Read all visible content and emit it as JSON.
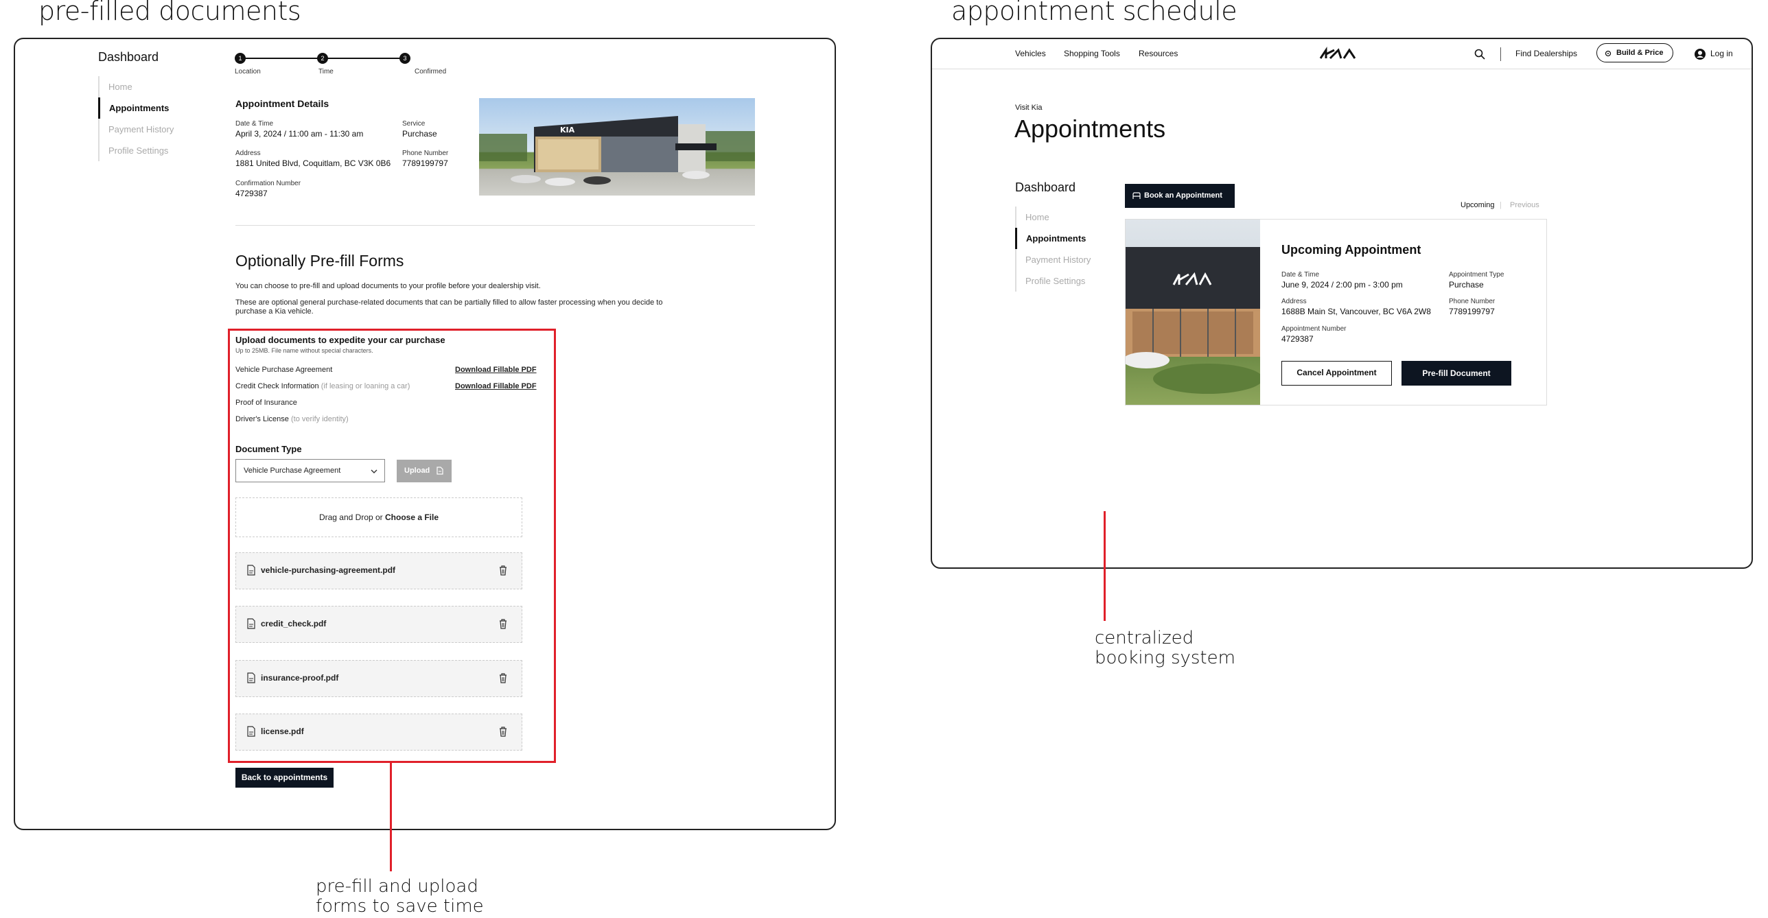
{
  "headings": {
    "left": "pre-filled documents",
    "right": "appointment schedule"
  },
  "annotations": {
    "left_line1": "pre-fill and upload",
    "left_line2": "forms to save time",
    "right_line1": "centralized",
    "right_line2": "booking system"
  },
  "colors": {
    "accent_red": "#e0202a",
    "dark_button": "#0d1521",
    "muted_text": "#999999"
  },
  "left_screen": {
    "sidebar": {
      "title": "Dashboard",
      "items": [
        {
          "label": "Home",
          "active": false
        },
        {
          "label": "Appointments",
          "active": true
        },
        {
          "label": "Payment History",
          "active": false
        },
        {
          "label": "Profile Settings",
          "active": false
        }
      ]
    },
    "stepper": {
      "steps": [
        {
          "num": "1",
          "label": "Location"
        },
        {
          "num": "2",
          "label": "Time"
        },
        {
          "num": "3",
          "label": "Confirmed"
        }
      ]
    },
    "details": {
      "title": "Appointment Details",
      "date_label": "Date & Time",
      "date_value": "April 3, 2024 / 11:00 am - 11:30 am",
      "service_label": "Service",
      "service_value": "Purchase",
      "address_label": "Address",
      "address_value": "1881 United Blvd, Coquitlam, BC V3K 0B6",
      "phone_label": "Phone Number",
      "phone_value": "7789199797",
      "confirmation_label": "Confirmation Number",
      "confirmation_value": "4729387"
    },
    "prefill": {
      "title": "Optionally Pre-fill Forms",
      "desc1": "You can choose to pre-fill and upload documents to your profile before your dealership visit.",
      "desc2a": "These are optional general purchase-related documents that can be partially filled to allow faster processing when you decide to",
      "desc2b": "purchase a Kia vehicle."
    },
    "upload": {
      "title": "Upload documents to expedite your car purchase",
      "subtitle": "Up to 25MB. File name without special characters.",
      "docs": [
        {
          "name": "Vehicle Purchase Agreement",
          "note": "",
          "link": "Download Fillable PDF"
        },
        {
          "name": "Credit Check Information",
          "note": "(if leasing or loaning a car)",
          "link": "Download Fillable PDF"
        },
        {
          "name": "Proof of Insurance",
          "note": "",
          "link": ""
        },
        {
          "name": "Driver's License",
          "note": "(to verify identity)",
          "link": ""
        }
      ],
      "doc_type_label": "Document Type",
      "doc_type_selected": "Vehicle Purchase Agreement",
      "upload_button": "Upload",
      "drop_text": "Drag and Drop or ",
      "drop_link": "Choose a File",
      "files": [
        "vehicle-purchasing-agreement.pdf",
        "credit_check.pdf",
        "insurance-proof.pdf",
        "license.pdf"
      ]
    },
    "back_button": "Back to appointments"
  },
  "right_screen": {
    "nav": {
      "links": [
        "Vehicles",
        "Shopping Tools",
        "Resources"
      ],
      "logo": "KIA",
      "find_dealerships": "Find Dealerships",
      "build_price": "Build & Price",
      "login": "Log in"
    },
    "eyebrow": "Visit Kia",
    "page_title": "Appointments",
    "sidebar": {
      "title": "Dashboard",
      "items": [
        {
          "label": "Home",
          "active": false
        },
        {
          "label": "Appointments",
          "active": true
        },
        {
          "label": "Payment History",
          "active": false
        },
        {
          "label": "Profile Settings",
          "active": false
        }
      ]
    },
    "book_button": "Book an Appointment",
    "tabs": {
      "upcoming": "Upcoming",
      "separator": "|",
      "previous": "Previous"
    },
    "card": {
      "title": "Upcoming Appointment",
      "date_label": "Date & Time",
      "date_value": "June 9, 2024 / 2:00 pm - 3:00 pm",
      "type_label": "Appointment Type",
      "type_value": "Purchase",
      "address_label": "Address",
      "address_value": "1688B Main St, Vancouver, BC V6A 2W8",
      "phone_label": "Phone Number",
      "phone_value": "7789199797",
      "number_label": "Appointment Number",
      "number_value": "4729387",
      "cancel_button": "Cancel Appointment",
      "prefill_button": "Pre-fill Document"
    }
  }
}
